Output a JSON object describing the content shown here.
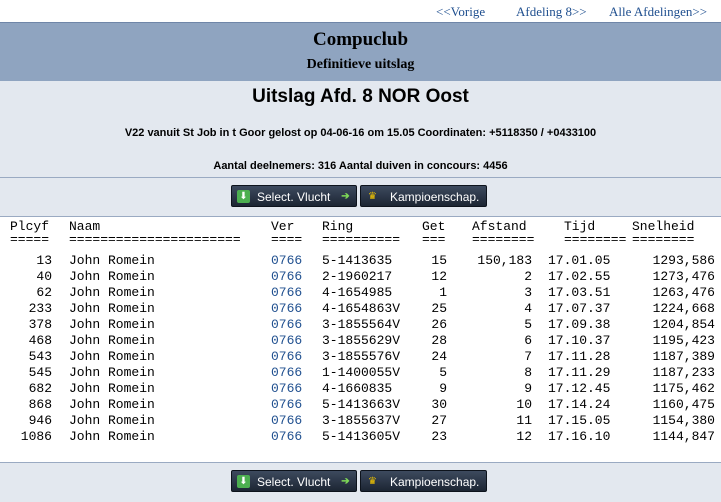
{
  "nav": {
    "prev": "<<Vorige",
    "next": "Afdeling 8>>",
    "all": "Alle Afdelingen>>"
  },
  "banner": {
    "club": "Compuclub",
    "subtitle": "Definitieve uitslag"
  },
  "info": {
    "title": "Uitslag Afd. 8 NOR Oost",
    "flight": "V22 vanuit St Job in t Goor gelost op 04-06-16 om 15.05 Coordinaten: +5118350 / +0433100",
    "counts": "Aantal deelnemers: 316 Aantal duiven in concours: 4456"
  },
  "buttons": {
    "select_vlucht": "Select. Vlucht",
    "kampioenschap": "Kampioenschap."
  },
  "table": {
    "headers": {
      "plcyf": "Plcyf",
      "naam": "Naam",
      "ver": "Ver",
      "ring": "Ring",
      "get": "Get",
      "afstand": "Afstand",
      "tijd": "Tijd",
      "snelheid": "Snelheid"
    },
    "underlines": {
      "plcyf": "=====",
      "naam": "======================",
      "ver": "====",
      "ring": "==========",
      "get": "===",
      "afstand": "========",
      "tijd": "========",
      "snelheid": "========"
    },
    "rows": [
      {
        "plcyf": "13",
        "naam": "John Romein",
        "ver": "0766",
        "ring": "5-1413635",
        "get": "15",
        "afstand": "150,183",
        "tijd": "17.01.05",
        "snelheid": "1293,586"
      },
      {
        "plcyf": "40",
        "naam": "John Romein",
        "ver": "0766",
        "ring": "2-1960217",
        "get": "12",
        "afstand": "2",
        "tijd": "17.02.55",
        "snelheid": "1273,476"
      },
      {
        "plcyf": "62",
        "naam": "John Romein",
        "ver": "0766",
        "ring": "4-1654985",
        "get": "1",
        "afstand": "3",
        "tijd": "17.03.51",
        "snelheid": "1263,476"
      },
      {
        "plcyf": "233",
        "naam": "John Romein",
        "ver": "0766",
        "ring": "4-1654863V",
        "get": "25",
        "afstand": "4",
        "tijd": "17.07.37",
        "snelheid": "1224,668"
      },
      {
        "plcyf": "378",
        "naam": "John Romein",
        "ver": "0766",
        "ring": "3-1855564V",
        "get": "26",
        "afstand": "5",
        "tijd": "17.09.38",
        "snelheid": "1204,854"
      },
      {
        "plcyf": "468",
        "naam": "John Romein",
        "ver": "0766",
        "ring": "3-1855629V",
        "get": "28",
        "afstand": "6",
        "tijd": "17.10.37",
        "snelheid": "1195,423"
      },
      {
        "plcyf": "543",
        "naam": "John Romein",
        "ver": "0766",
        "ring": "3-1855576V",
        "get": "24",
        "afstand": "7",
        "tijd": "17.11.28",
        "snelheid": "1187,389"
      },
      {
        "plcyf": "545",
        "naam": "John Romein",
        "ver": "0766",
        "ring": "1-1400055V",
        "get": "5",
        "afstand": "8",
        "tijd": "17.11.29",
        "snelheid": "1187,233"
      },
      {
        "plcyf": "682",
        "naam": "John Romein",
        "ver": "0766",
        "ring": "4-1660835",
        "get": "9",
        "afstand": "9",
        "tijd": "17.12.45",
        "snelheid": "1175,462"
      },
      {
        "plcyf": "868",
        "naam": "John Romein",
        "ver": "0766",
        "ring": "5-1413663V",
        "get": "30",
        "afstand": "10",
        "tijd": "17.14.24",
        "snelheid": "1160,475"
      },
      {
        "plcyf": "946",
        "naam": "John Romein",
        "ver": "0766",
        "ring": "3-1855637V",
        "get": "27",
        "afstand": "11",
        "tijd": "17.15.05",
        "snelheid": "1154,380"
      },
      {
        "plcyf": "1086",
        "naam": "John Romein",
        "ver": "0766",
        "ring": "5-1413605V",
        "get": "23",
        "afstand": "12",
        "tijd": "17.16.10",
        "snelheid": "1144,847"
      }
    ]
  }
}
